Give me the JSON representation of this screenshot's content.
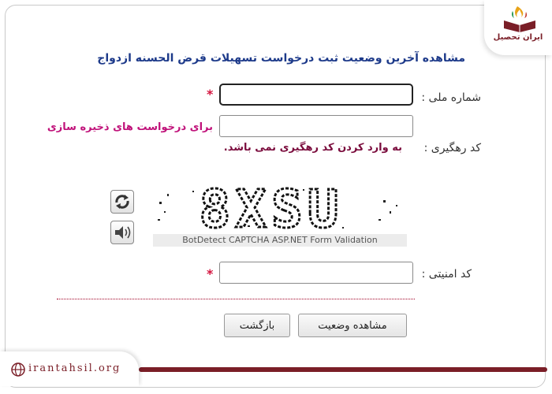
{
  "logo": {
    "text": "ایران تحصیل",
    "icon": "book-flame-logo"
  },
  "title": "مشاهده آخرین وضعیت ثبت درخواست تسهیلات قرض الحسنه ازدواج",
  "form": {
    "national_id": {
      "label": "شماره ملی :",
      "value": "",
      "required_mark": "*"
    },
    "tracking": {
      "label": "کد رهگیری :",
      "value": "",
      "hint_right": "برای درخواست های ذخیره سازی",
      "hint_below": "به وارد کردن کد رهگیری نمی باشد."
    },
    "captcha": {
      "text": "8XSU",
      "caption": "BotDetect CAPTCHA ASP.NET Form Validation",
      "reload_icon": "reload-icon",
      "sound_icon": "speaker-icon"
    },
    "security_code": {
      "label": "کد امنیتی :",
      "value": "",
      "required_mark": "*"
    }
  },
  "buttons": {
    "view_status": "مشاهده وضعیت",
    "back": "بازگشت"
  },
  "footer": {
    "url": "irantahsil.org",
    "icon": "globe-icon"
  },
  "colors": {
    "title": "#1d3a8a",
    "hint": "#c0127a",
    "hint_dark": "#7a0b3c",
    "accent": "#7a1e27",
    "required": "#d4143f"
  }
}
